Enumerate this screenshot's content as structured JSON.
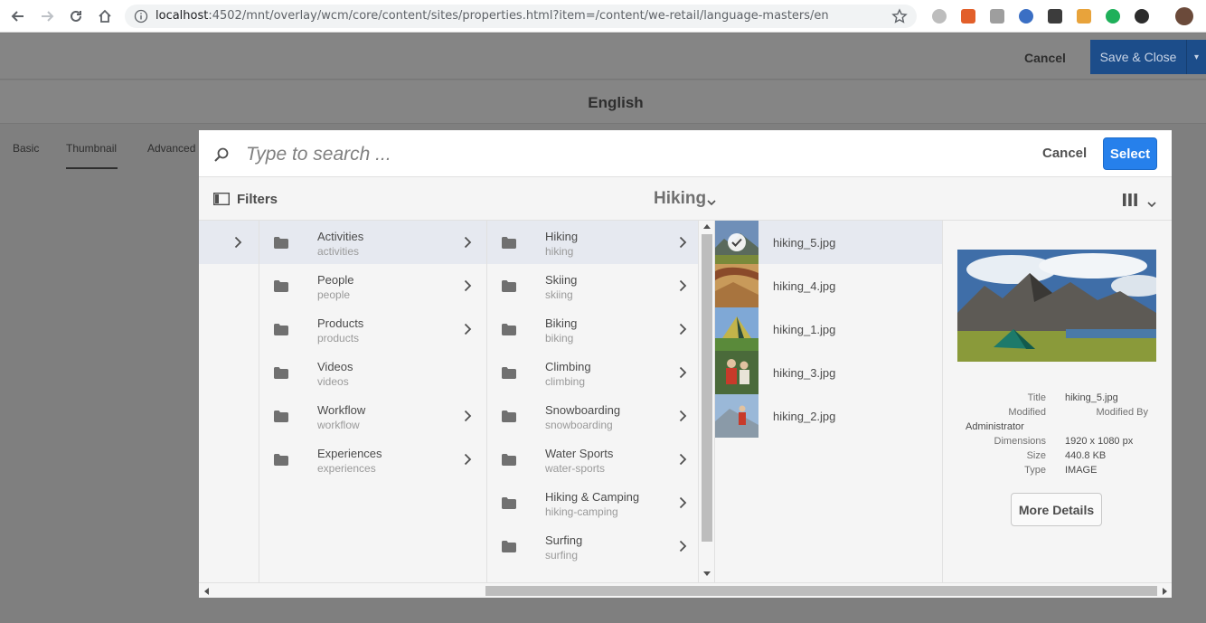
{
  "browser": {
    "url_host": "localhost",
    "url_rest": ":4502/mnt/overlay/wcm/core/content/sites/properties.html?item=/content/we-retail/language-masters/en"
  },
  "page": {
    "cancel_label": "Cancel",
    "save_label": "Save & Close",
    "title": "English",
    "tabs": [
      {
        "label": "Basic"
      },
      {
        "label": "Thumbnail"
      },
      {
        "label": "Advanced"
      }
    ],
    "active_tab": "Thumbnail"
  },
  "picker": {
    "search_placeholder": "Type to search ...",
    "cancel_label": "Cancel",
    "select_label": "Select",
    "filters_label": "Filters",
    "current_folder": "Hiking",
    "column1": [
      {
        "name": "Activities",
        "path": "activities",
        "has_children": true,
        "selected": true
      },
      {
        "name": "People",
        "path": "people",
        "has_children": true
      },
      {
        "name": "Products",
        "path": "products",
        "has_children": true
      },
      {
        "name": "Videos",
        "path": "videos",
        "has_children": false
      },
      {
        "name": "Workflow",
        "path": "workflow",
        "has_children": true
      },
      {
        "name": "Experiences",
        "path": "experiences",
        "has_children": true
      }
    ],
    "column2": [
      {
        "name": "Hiking",
        "path": "hiking",
        "has_children": true,
        "selected": true
      },
      {
        "name": "Skiing",
        "path": "skiing",
        "has_children": true
      },
      {
        "name": "Biking",
        "path": "biking",
        "has_children": true
      },
      {
        "name": "Climbing",
        "path": "climbing",
        "has_children": true
      },
      {
        "name": "Snowboarding",
        "path": "snowboarding",
        "has_children": true
      },
      {
        "name": "Water Sports",
        "path": "water-sports",
        "has_children": true
      },
      {
        "name": "Hiking & Camping",
        "path": "hiking-camping",
        "has_children": true
      },
      {
        "name": "Surfing",
        "path": "surfing",
        "has_children": true
      }
    ],
    "assets": [
      {
        "name": "hiking_5.jpg",
        "selected": true
      },
      {
        "name": "hiking_4.jpg"
      },
      {
        "name": "hiking_1.jpg"
      },
      {
        "name": "hiking_3.jpg"
      },
      {
        "name": "hiking_2.jpg"
      }
    ],
    "details": {
      "title_label": "Title",
      "title_value": "hiking_5.jpg",
      "modified_label": "Modified",
      "modified_by_label": "Modified By",
      "modified_by_value": "Administrator",
      "dimensions_label": "Dimensions",
      "dimensions_value": "1920 x 1080 px",
      "size_label": "Size",
      "size_value": "440.8 KB",
      "type_label": "Type",
      "type_value": "IMAGE",
      "more_details_label": "More Details"
    }
  },
  "colors": {
    "primary": "#2680eb",
    "selected_row": "#e6e9f0",
    "overlay": "#7f7f7f"
  }
}
